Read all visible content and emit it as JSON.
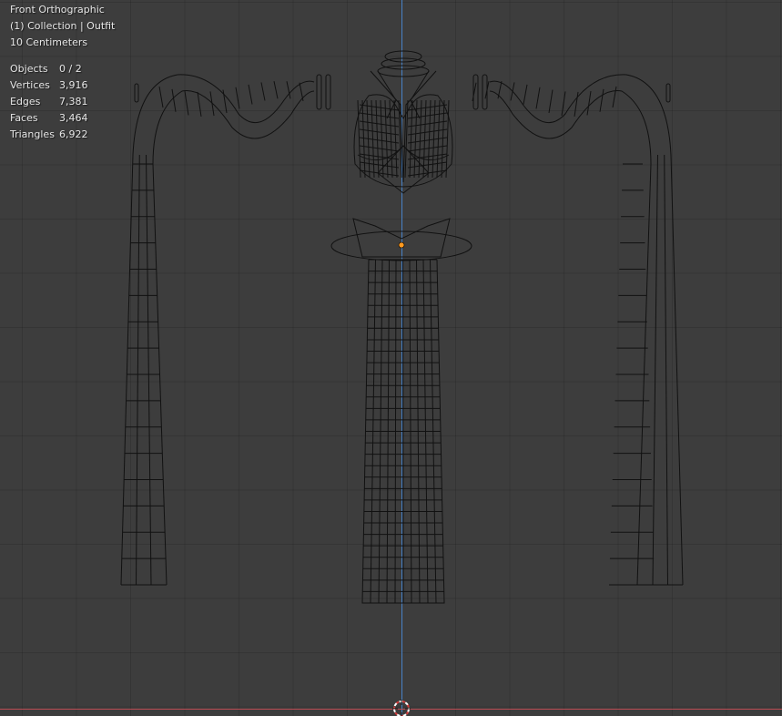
{
  "viewport": {
    "view_name": "Front Orthographic",
    "collection_label": "(1) Collection | Outfit",
    "scale_label": "10 Centimeters"
  },
  "stats": [
    {
      "label": "Objects",
      "value": "0 / 2"
    },
    {
      "label": "Vertices",
      "value": "3,916"
    },
    {
      "label": "Edges",
      "value": "7,381"
    },
    {
      "label": "Faces",
      "value": "3,464"
    },
    {
      "label": "Triangles",
      "value": "6,922"
    }
  ],
  "colors": {
    "background": "#3d3d3d",
    "wire": "#111111",
    "z_axis": "#4a84c9",
    "x_axis": "#b84a52",
    "origin": "#ff9a1f"
  },
  "icons": {
    "cursor": "3d-cursor-icon",
    "origin": "object-origin-icon"
  }
}
